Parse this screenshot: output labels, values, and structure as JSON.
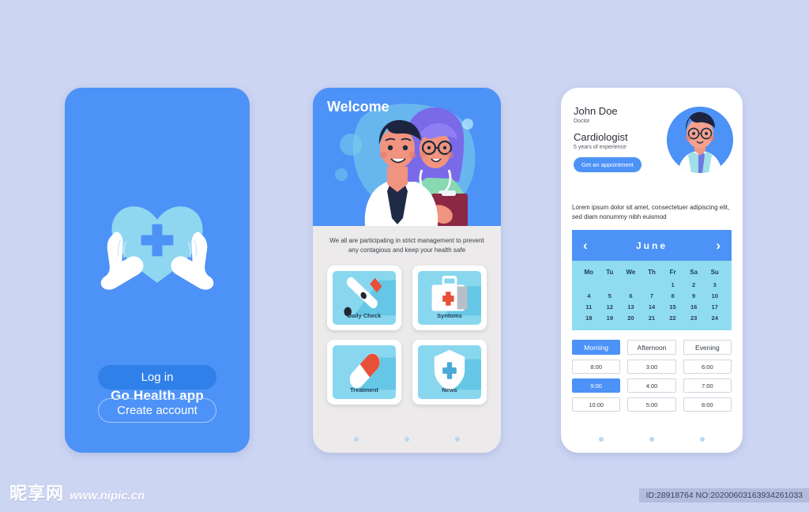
{
  "meta": {
    "background_color": "#ccd5f2",
    "accent_blue": "#4d92f6",
    "accent_blue_dark": "#2f80e8",
    "cyan": "#89d7ef",
    "calendar_body": "#8fdcf0"
  },
  "screen1": {
    "name": "login-screen",
    "app_title": "Go Health app",
    "logo_icon": "heart-with-cross-in-hands-icon",
    "login_label": "Log in",
    "create_account_label": "Create account"
  },
  "screen2": {
    "name": "welcome-screen",
    "welcome_title": "Welcome",
    "hero_icon": "two-doctors-illustration",
    "caption": "We all are participating in strict management to prevent any contagious and keep your health safe",
    "cards": [
      {
        "label": "Daily Check",
        "icon": "thermometer-icon"
      },
      {
        "label": "Syntoms",
        "icon": "first-aid-kit-icon"
      },
      {
        "label": "Treatment",
        "icon": "pill-capsule-icon"
      },
      {
        "label": "News",
        "icon": "shield-with-cross-icon"
      }
    ],
    "pagination_dots": 3
  },
  "screen3": {
    "name": "doctor-profile-screen",
    "doctor_name": "John Doe",
    "doctor_role": "Doctor",
    "speciality": "Cardiologist",
    "experience": "5 years of experience",
    "appointment_button": "Get an appointment",
    "avatar_icon": "doctor-avatar-icon",
    "bio": "Lorem ipsum dolor sit amet, consectetuer adipiscing elit, sed diam nonummy nibh euismod",
    "calendar": {
      "prev_icon": "chevron-left-icon",
      "next_icon": "chevron-right-icon",
      "month": "June",
      "weekdays": [
        "Mo",
        "Tu",
        "We",
        "Th",
        "Fr",
        "Sa",
        "Su"
      ],
      "leading_blanks": 4,
      "days": [
        1,
        2,
        3,
        4,
        5,
        6,
        7,
        8,
        9,
        10,
        11,
        12,
        13,
        14,
        15,
        16,
        17,
        18,
        19,
        20,
        21,
        22,
        23,
        24
      ]
    },
    "slots": [
      {
        "period": "Morning",
        "selected_period": true,
        "times": [
          "8:00",
          "9:00",
          "10:00"
        ],
        "selected_time": "9:00"
      },
      {
        "period": "Afternoon",
        "selected_period": false,
        "times": [
          "3:00",
          "4:00",
          "5:00"
        ],
        "selected_time": null
      },
      {
        "period": "Evening",
        "selected_period": false,
        "times": [
          "6:00",
          "7:00",
          "8:00"
        ],
        "selected_time": null
      }
    ],
    "pagination_dots": 3
  },
  "watermark": {
    "logo_text": "昵享网",
    "url": "www.nipic.cn",
    "id_text": "ID:28918764 NO:20200603163934261033"
  }
}
